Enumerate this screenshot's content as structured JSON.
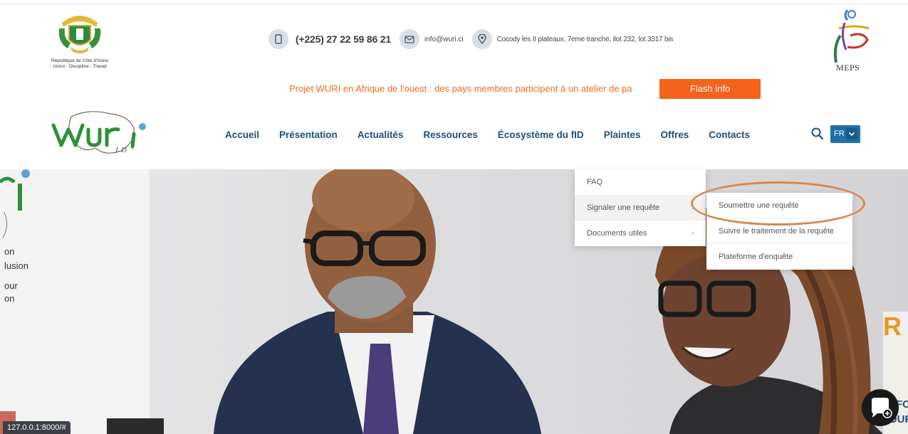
{
  "header": {
    "coat_of_arms": {
      "line1": "République de Côte d'Ivoire",
      "line2": "Union - Discipline - Travail"
    },
    "phone": "(+225) 27 22 59 86 21",
    "email": "info@wuri.ci",
    "address": "Cocody les II plateaux, 7eme tranche, ilot 232, lot 3317 bis",
    "partner_logo_text": "MEPS",
    "ticker_text": "Projet WURI en Afrique de l'ouest : des pays membres participent à un atelier de pa",
    "flash_button": "Flash info"
  },
  "nav": {
    "items": [
      {
        "label": "Accueil"
      },
      {
        "label": "Présentation"
      },
      {
        "label": "Actualités"
      },
      {
        "label": "Ressources"
      },
      {
        "label": "Écosystème du fID"
      },
      {
        "label": "Plaintes"
      },
      {
        "label": "Offres"
      },
      {
        "label": "Contacts"
      }
    ],
    "language": "FR"
  },
  "dropdown_plaintes": {
    "items": [
      {
        "label": "FAQ"
      },
      {
        "label": "Signaler une requête"
      },
      {
        "label": "Documents utiles"
      }
    ]
  },
  "submenu_signaler": {
    "items": [
      {
        "label": "Soumettre une requête"
      },
      {
        "label": "Suivre le traitement de la requête"
      },
      {
        "label": "Plateforme d'enquête"
      }
    ]
  },
  "hero": {
    "left_text": [
      "on",
      "lusion",
      "our",
      "on"
    ],
    "right_text": [
      "R",
      "FC",
      "OUR"
    ]
  },
  "status_bar_url": "127.0.0.1:8000/#",
  "colors": {
    "nav_text": "#1f4e79",
    "accent_orange": "#f4621b",
    "highlight_ring": "#d9874b",
    "lang_button": "#1f6fa8"
  }
}
